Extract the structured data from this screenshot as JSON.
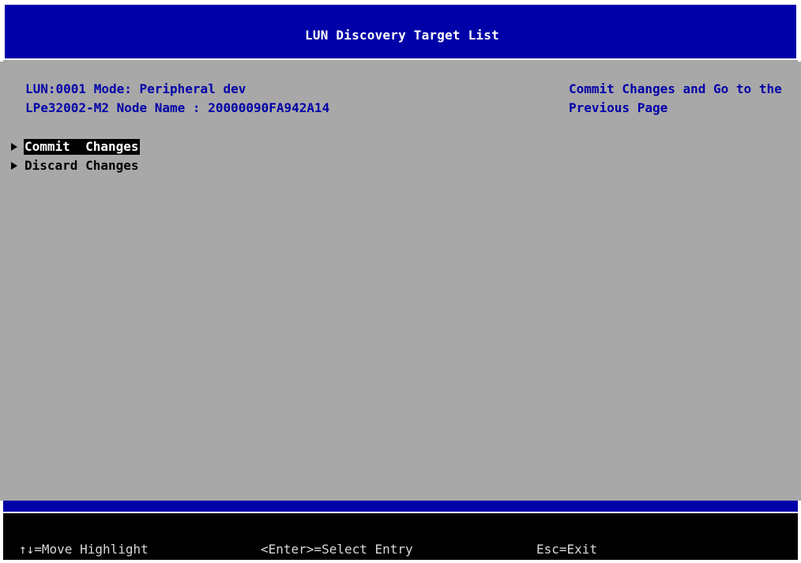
{
  "title": "LUN Discovery Target List",
  "info": {
    "line1": "LUN:0001 Mode: Peripheral dev",
    "line2": "LPe32002-M2 Node Name : 20000090FA942A14"
  },
  "help": {
    "line1": "Commit Changes and Go to the",
    "line2": "Previous Page"
  },
  "menu": {
    "items": [
      {
        "label": "Commit  Changes",
        "selected": true
      },
      {
        "label": "Discard Changes",
        "selected": false
      }
    ]
  },
  "footer": {
    "move": "↑↓=Move Highlight",
    "select": "<Enter>=Select Entry",
    "exit": "Esc=Exit"
  },
  "colors": {
    "background": "#a8a8a8",
    "title_bar": "#0000a8",
    "info_text": "#0000a8",
    "footer": "#000000"
  }
}
